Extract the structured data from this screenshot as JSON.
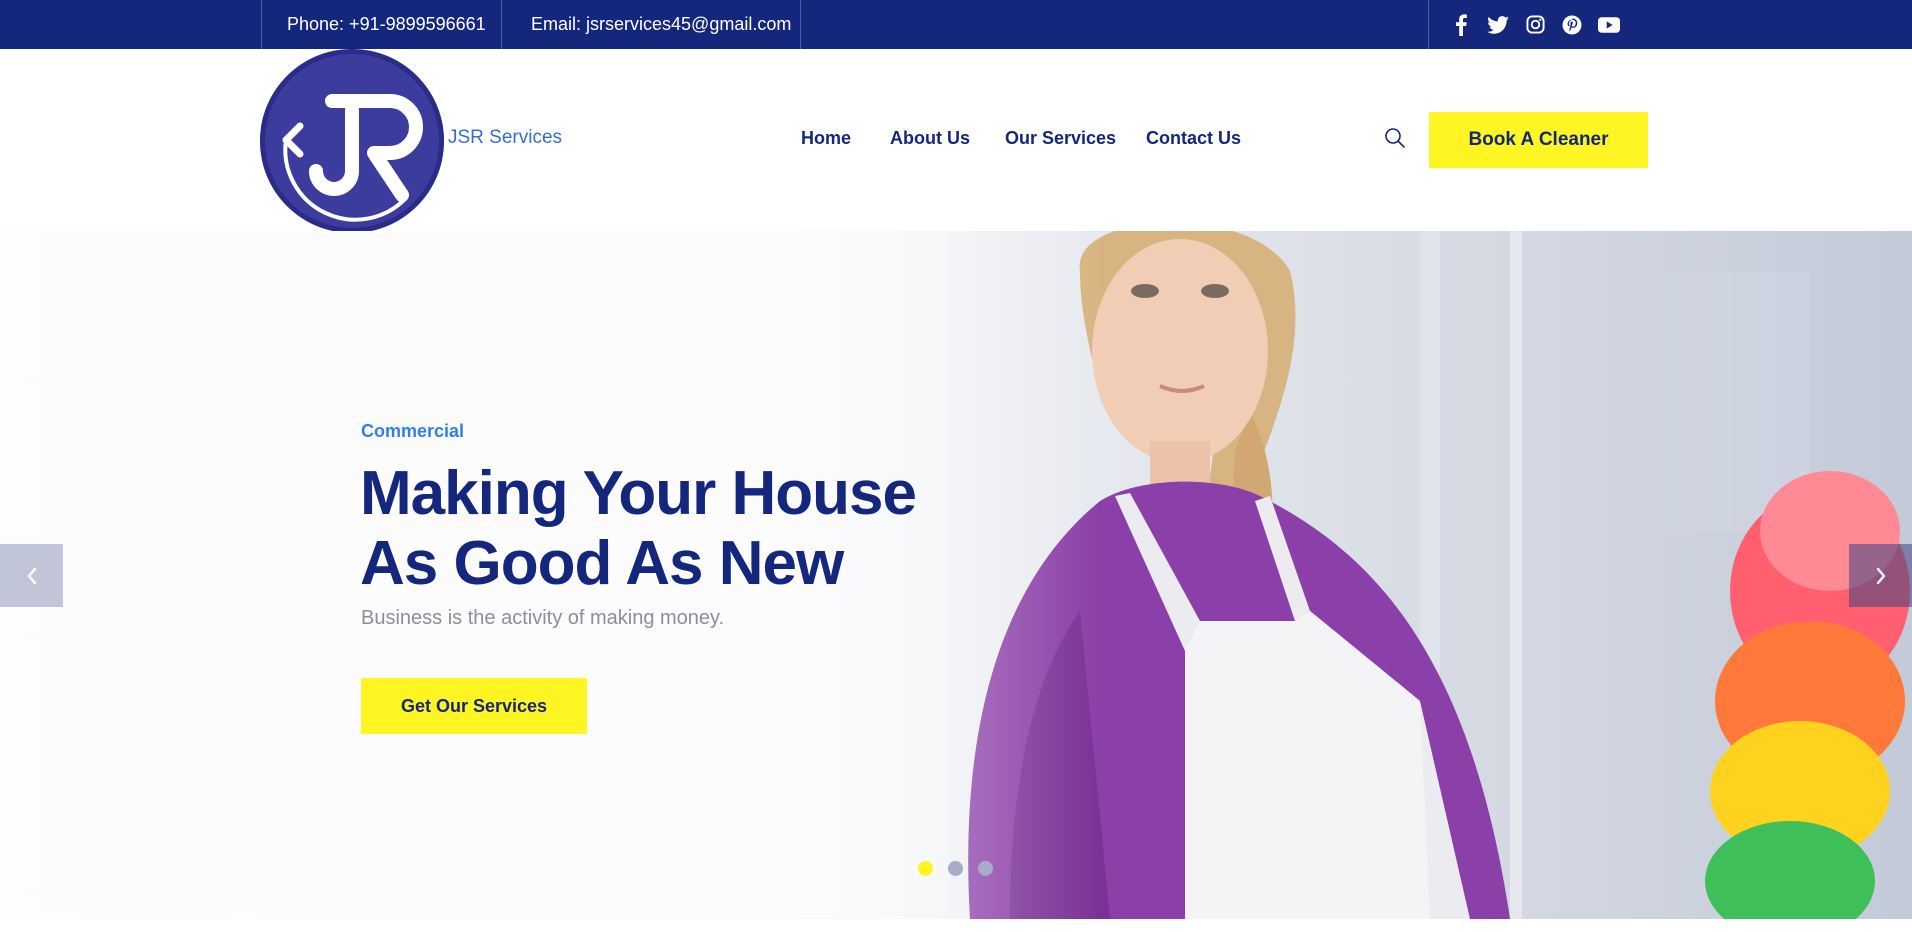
{
  "topbar": {
    "phone": "Phone: +91-9899596661",
    "email": "Email: jsrservices45@gmail.com",
    "social": [
      "facebook-icon",
      "twitter-icon",
      "instagram-icon",
      "pinterest-icon",
      "youtube-icon"
    ]
  },
  "header": {
    "brand": "JSR Services",
    "nav": [
      "Home",
      "About Us",
      "Our Services",
      "Contact Us"
    ],
    "cta": "Book A Cleaner"
  },
  "hero": {
    "eyebrow": "Commercial",
    "title_line1": "Making Your House",
    "title_line2": "As Good As New",
    "subtitle": "Business is the activity of making money.",
    "button": "Get Our Services",
    "slides_total": 3,
    "active_slide": 1
  },
  "colors": {
    "primary": "#14277c",
    "accent": "#fff523",
    "link": "#2f7fe8"
  }
}
